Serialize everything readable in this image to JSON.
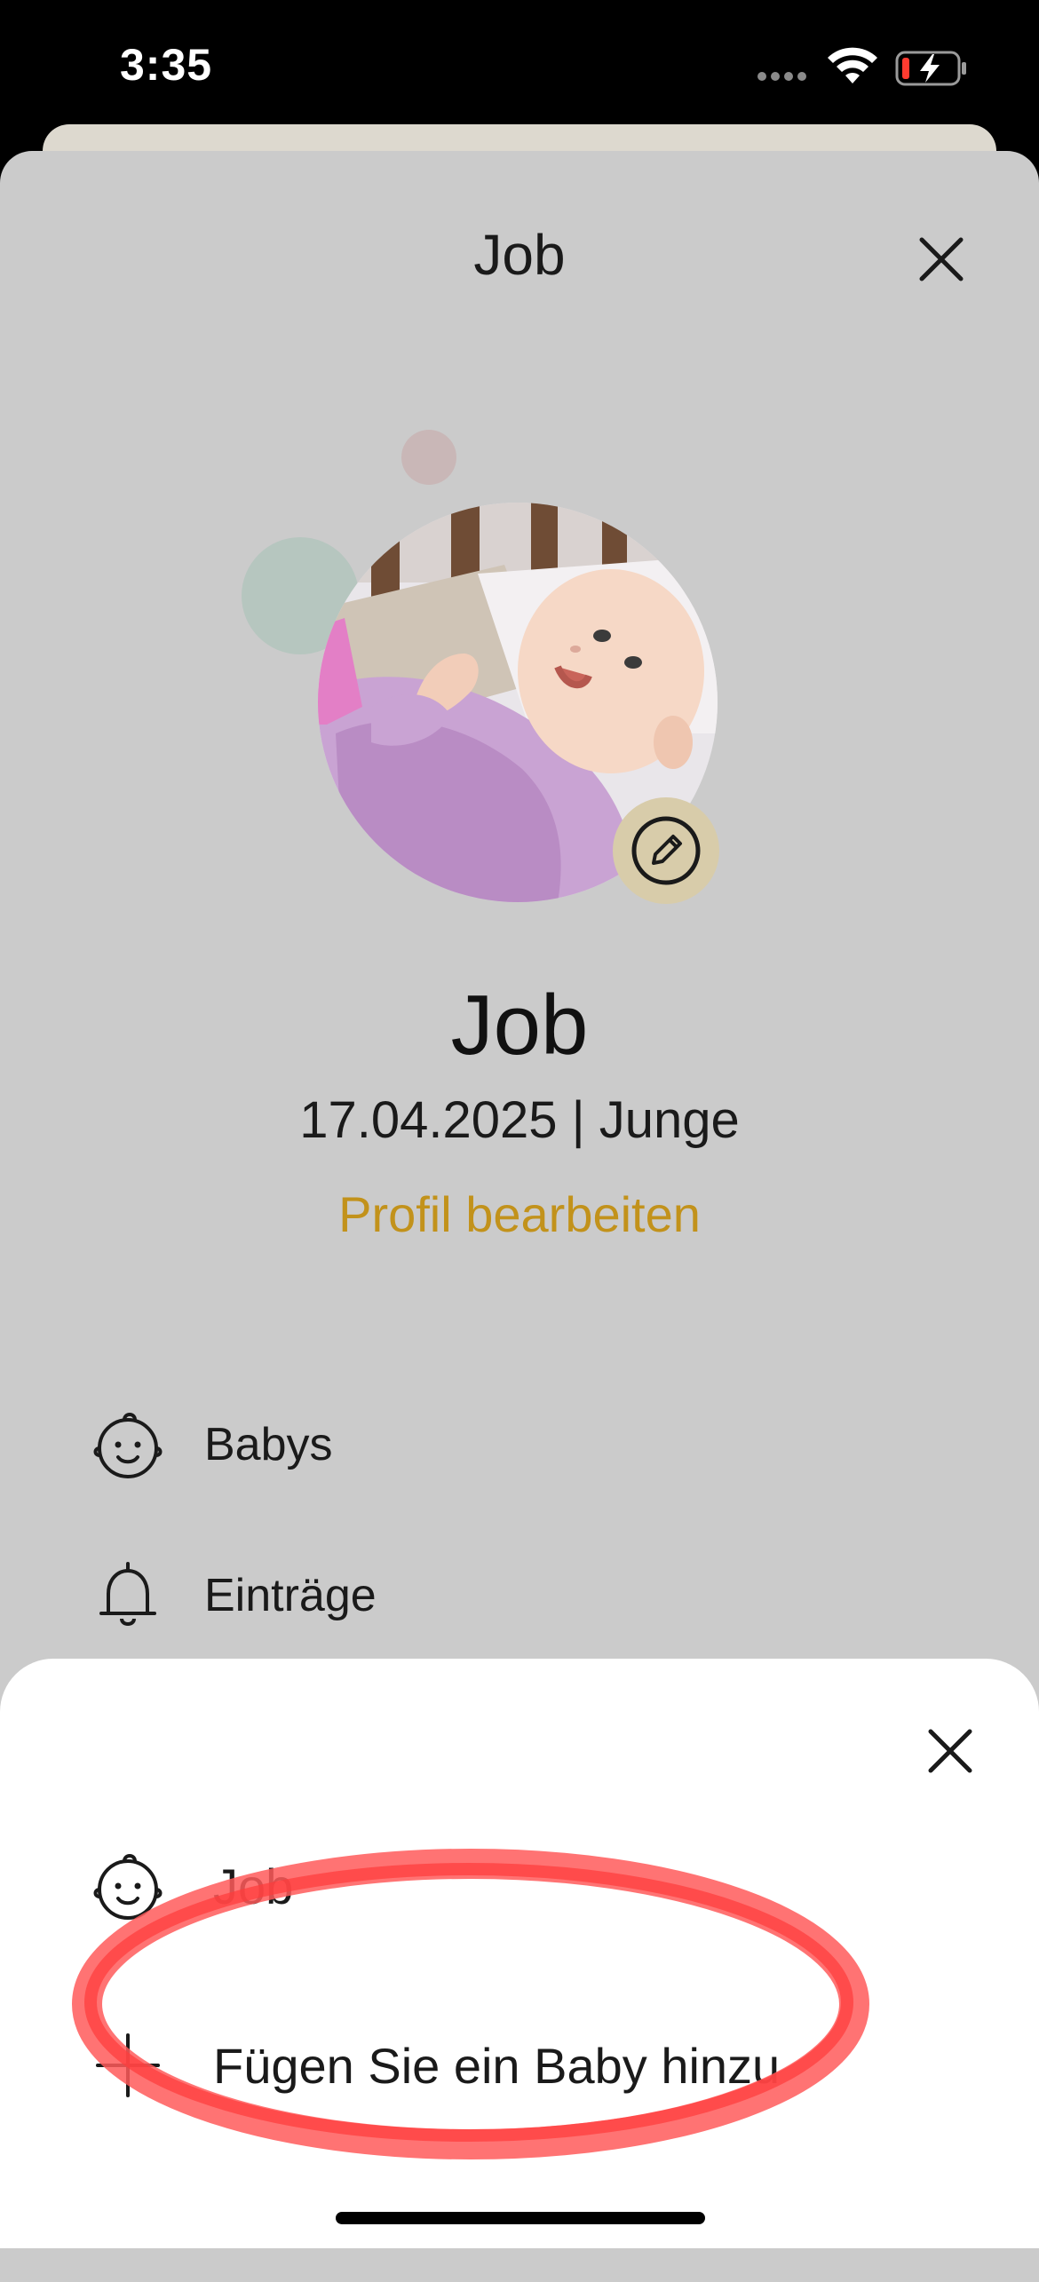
{
  "status_bar": {
    "time": "3:35",
    "icons": [
      "signal-dots-icon",
      "wifi-icon",
      "battery-charging-icon"
    ]
  },
  "modal": {
    "title": "Job",
    "close_icon": "close-icon",
    "profile": {
      "name": "Job",
      "meta": "17.04.2025 | Junge",
      "edit_link": "Profil bearbeiten",
      "edit_icon": "pencil-icon"
    },
    "menu": [
      {
        "icon": "baby-face-icon",
        "label": "Babys"
      },
      {
        "icon": "bell-icon",
        "label": "Einträge"
      }
    ]
  },
  "bottom_sheet": {
    "close_icon": "close-icon",
    "items": [
      {
        "icon": "baby-face-icon",
        "label": "Job"
      },
      {
        "icon": "plus-icon",
        "label": "Fügen Sie ein Baby hinzu"
      }
    ]
  },
  "colors": {
    "modal_bg": "#cbcbcb",
    "accent": "#c2921b",
    "highlight": "#ff4444",
    "edit_badge": "#d8ccaa"
  }
}
